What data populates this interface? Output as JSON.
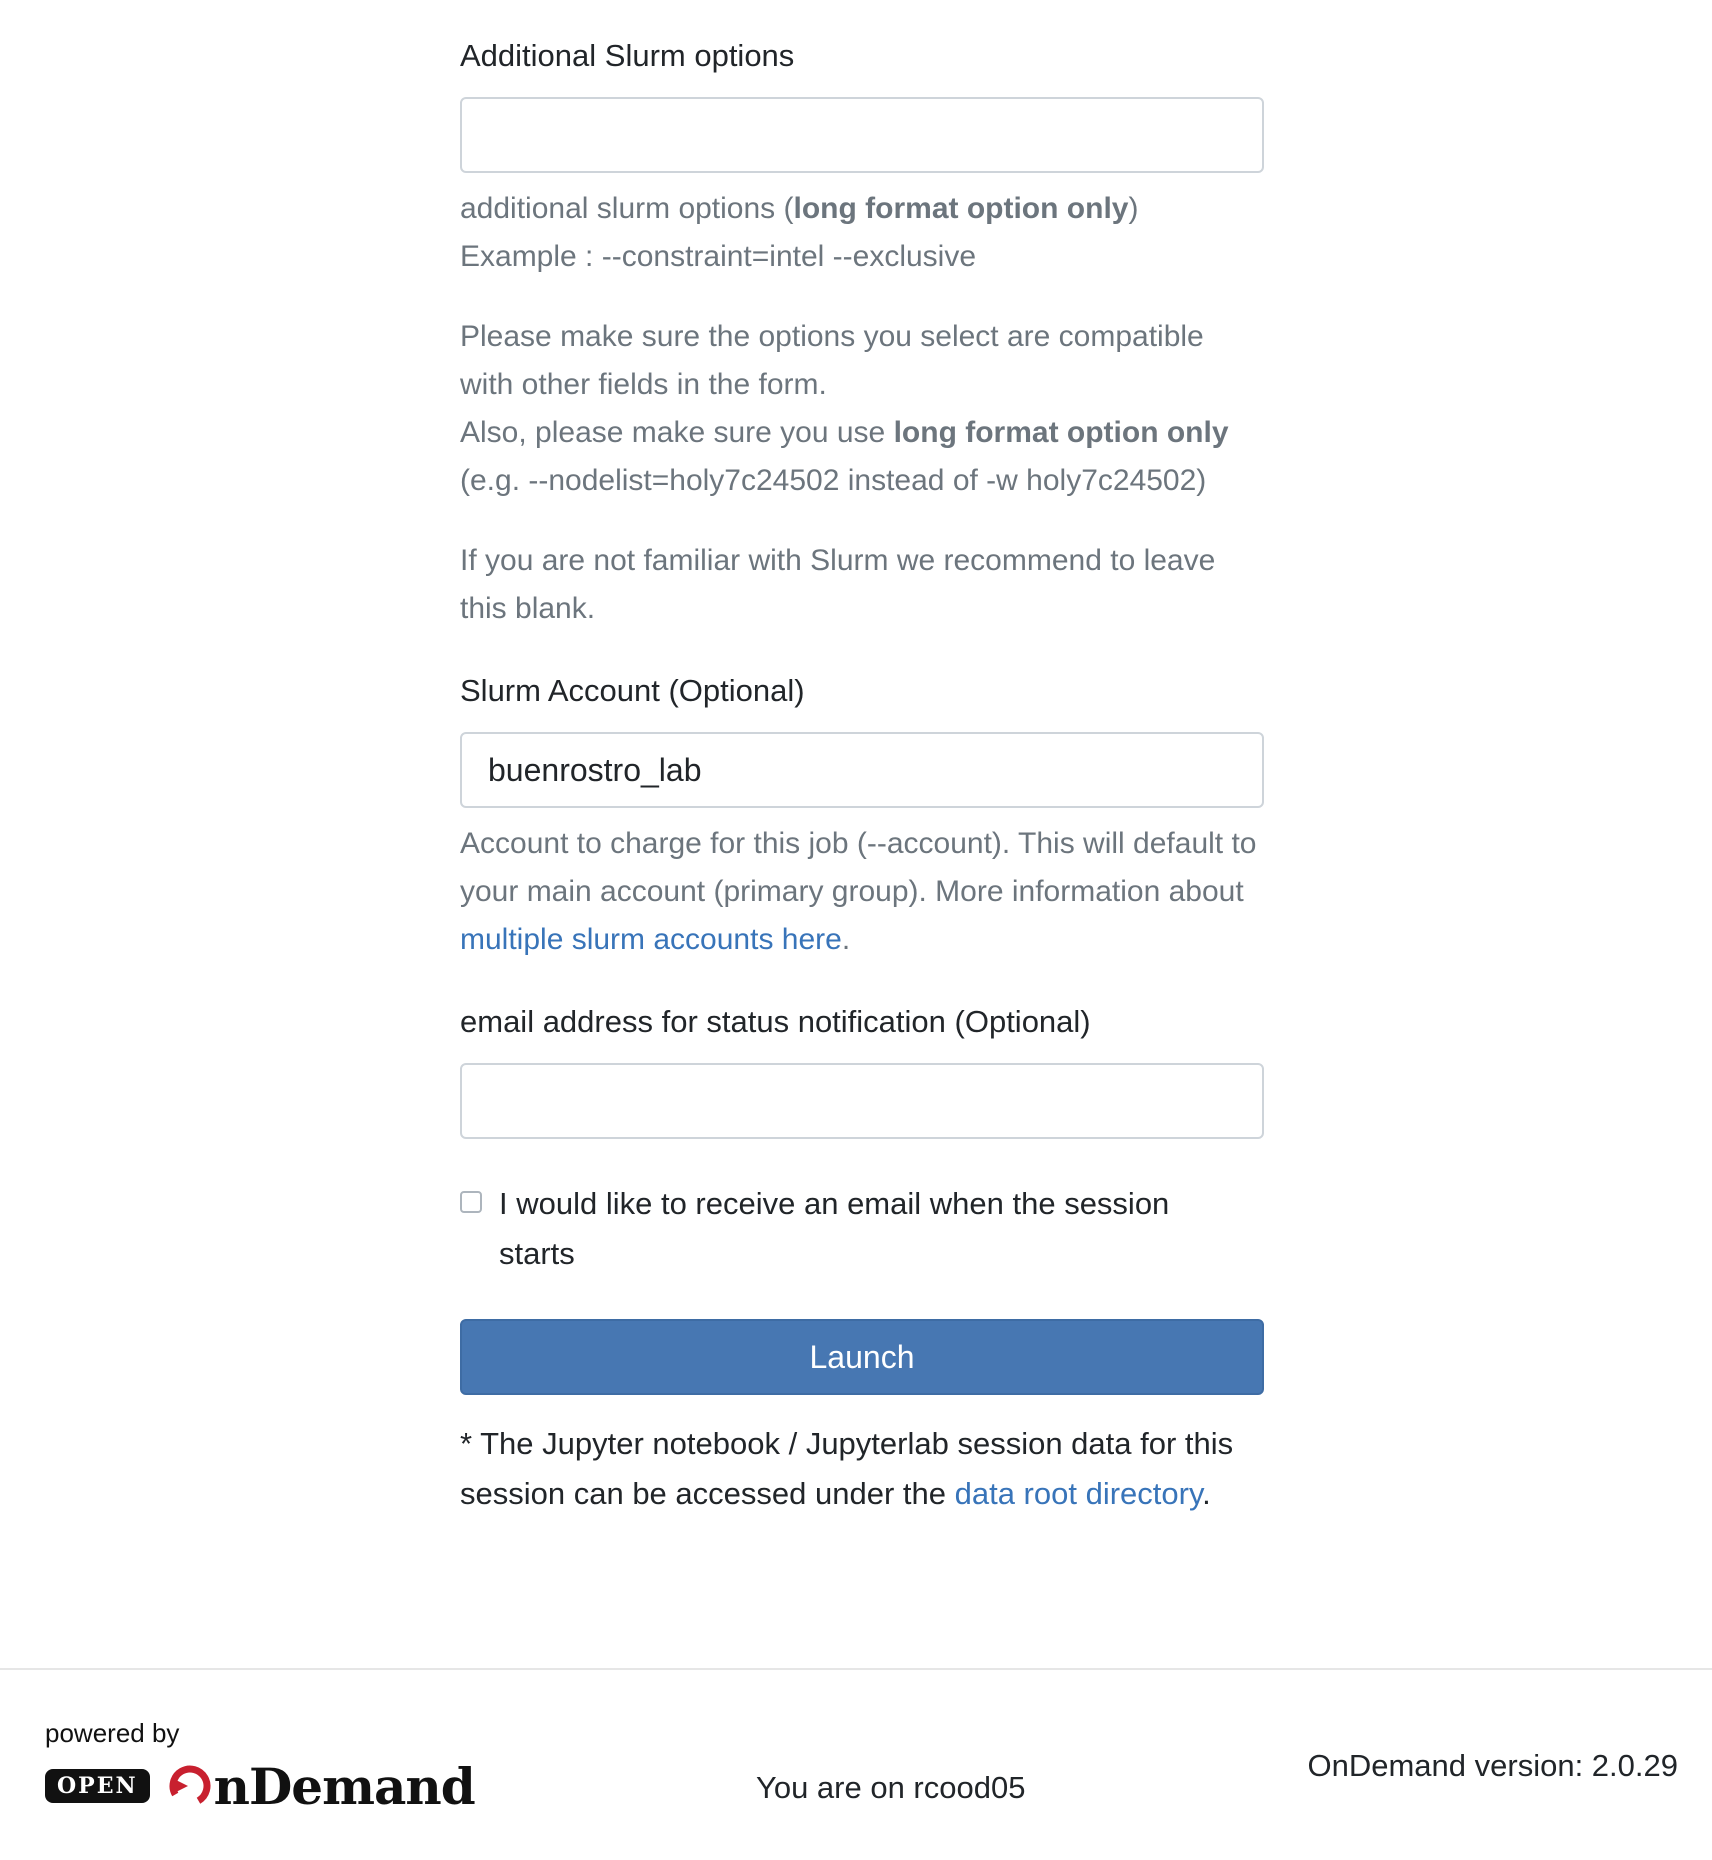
{
  "slurm_options": {
    "label": "Additional Slurm options",
    "value": "",
    "help_line1_prefix": "additional slurm options (",
    "help_line1_bold": "long format option only",
    "help_line1_suffix": ")",
    "help_example": "Example : --constraint=intel --exclusive",
    "help_compat": "Please make sure the options you select are compatible with other fields in the form.",
    "help_also_prefix": "Also, please make sure you use ",
    "help_also_bold": "long format option only",
    "help_also_suffix": "(e.g. --nodelist=holy7c24502 instead of -w holy7c24502)",
    "help_familiar": "If you are not familiar with Slurm we recommend to leave this blank."
  },
  "slurm_account": {
    "label": "Slurm Account (Optional)",
    "value": "buenrostro_lab",
    "help_prefix": "Account to charge for this job (--account). This will default to your main account (primary group). More information about ",
    "help_link": "multiple slurm accounts here",
    "help_suffix": "."
  },
  "email": {
    "label": "email address for status notification (Optional)",
    "value": "",
    "checkbox_label": "I would like to receive an email when the session starts",
    "checked": false
  },
  "launch": {
    "label": "Launch",
    "color": "#4777b2"
  },
  "note": {
    "prefix": "* The Jupyter notebook / Jupyterlab session data for this session can be accessed under the ",
    "link": "data root directory",
    "suffix": "."
  },
  "footer": {
    "powered_by": "powered by",
    "logo_open": "OPEN",
    "logo_word": "nDemand",
    "logo_icon": "ondemand-o-icon",
    "host": "You are on rcood05",
    "version": "OnDemand version: 2.0.29"
  },
  "colors": {
    "link": "#3874b9",
    "help_text": "#6c757d",
    "logo_accent": "#c8202f"
  }
}
